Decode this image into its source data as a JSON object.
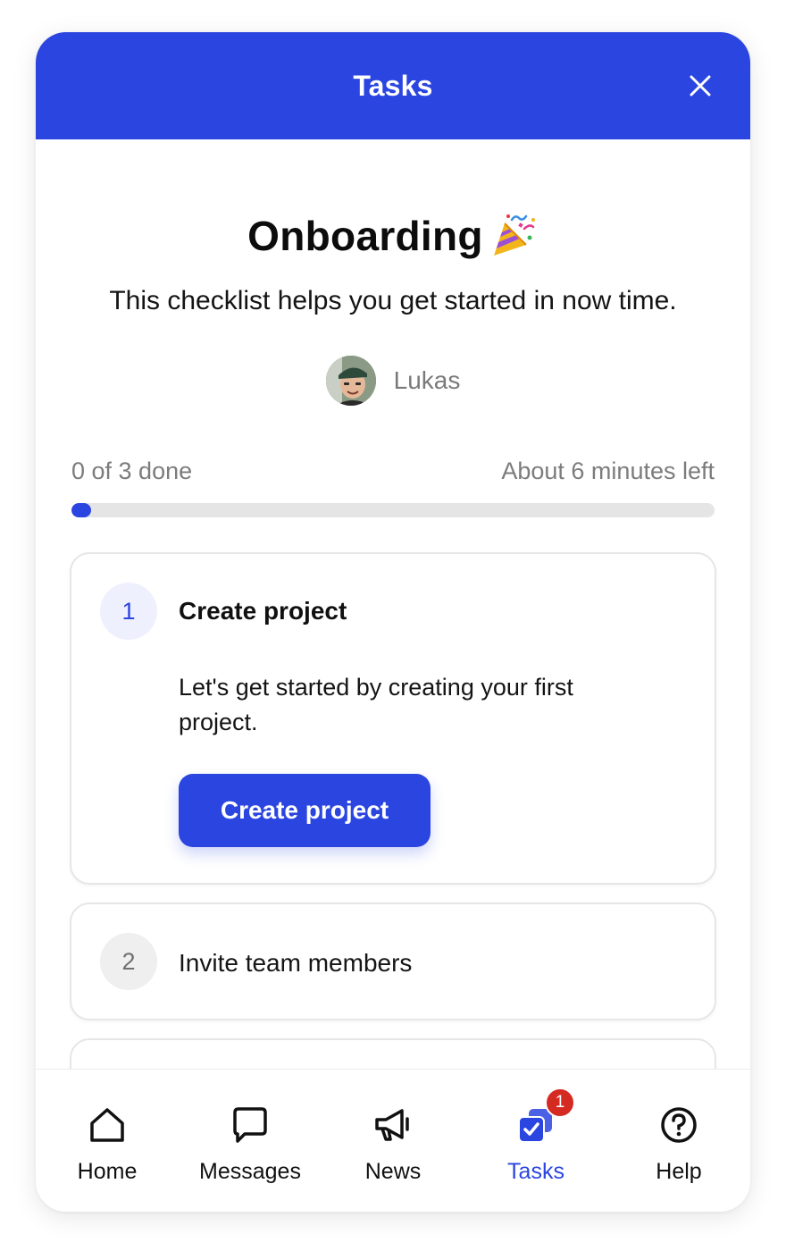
{
  "header": {
    "title": "Tasks",
    "close_icon": "close-icon"
  },
  "checklist": {
    "title": "Onboarding",
    "title_emoji": "party-popper-icon",
    "subtitle": "This checklist helps you get started in now time.",
    "author": {
      "name": "Lukas",
      "avatar": "avatar-photo"
    },
    "progress": {
      "done_label": "0 of 3 done",
      "time_left_label": "About 6 minutes left",
      "fraction": 0.03
    }
  },
  "tasks": [
    {
      "number": "1",
      "title": "Create project",
      "description": "Let's get started by creating your first project.",
      "button_label": "Create project",
      "state": "expanded"
    },
    {
      "number": "2",
      "title": "Invite team members",
      "state": "collapsed"
    }
  ],
  "nav": {
    "items": [
      {
        "label": "Home",
        "icon": "home-icon"
      },
      {
        "label": "Messages",
        "icon": "message-icon"
      },
      {
        "label": "News",
        "icon": "megaphone-icon"
      },
      {
        "label": "Tasks",
        "icon": "tasks-icon",
        "active": true,
        "badge": "1"
      },
      {
        "label": "Help",
        "icon": "help-icon"
      }
    ]
  },
  "colors": {
    "accent": "#2b45e0",
    "badge": "#d42a22",
    "muted_text": "#7c7c7c"
  }
}
